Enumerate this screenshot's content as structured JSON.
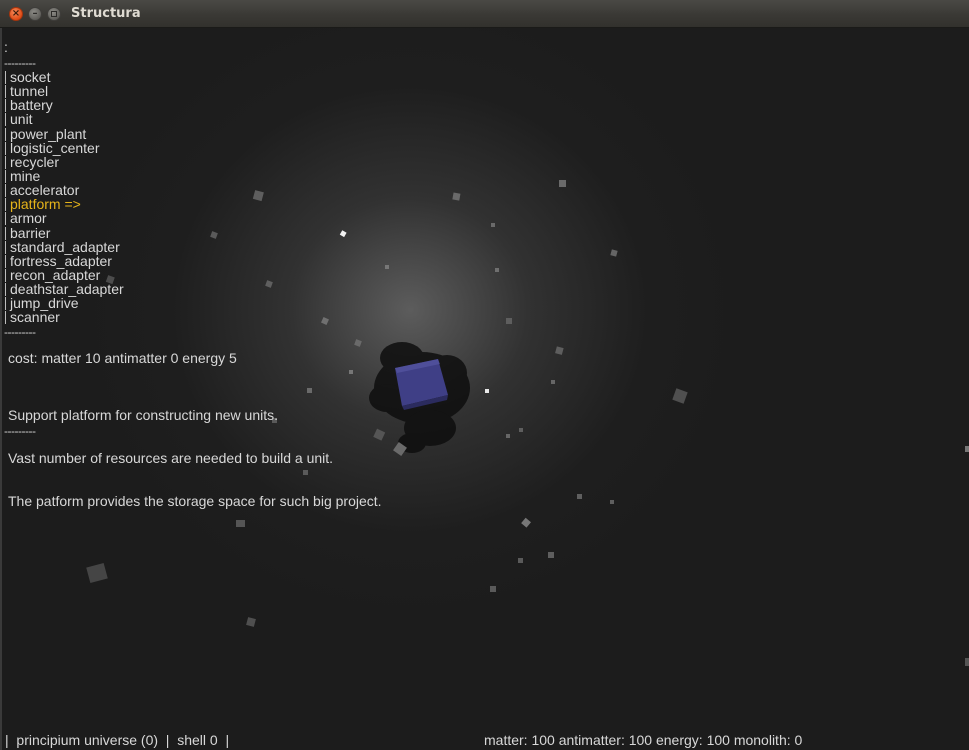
{
  "window": {
    "title": "Structura",
    "close_glyph": "×",
    "minimize_glyph": "–"
  },
  "hud": {
    "prompt": ":",
    "separator": "---------",
    "menu_items": [
      "socket",
      "tunnel",
      "battery",
      "unit",
      "power_plant",
      "logistic_center",
      "recycler",
      "mine",
      "accelerator",
      "platform =>",
      "armor",
      "barrier",
      "standard_adapter",
      "fortress_adapter",
      "recon_adapter",
      "deathstar_adapter",
      "jump_drive",
      "scanner"
    ],
    "selected_index": 9,
    "cost": "cost: matter 10 antimatter 0 energy 5",
    "description": [
      "Support platform for constructing new units.",
      "Vast number of resources are needed to build a unit.",
      "The patform provides the storage space for such big project."
    ]
  },
  "status_bar": {
    "left": "|  principium universe (0)  |  shell 0  |",
    "right": "matter: 100 antimatter: 100 energy: 100 monolith: 0"
  },
  "colors": {
    "hud_text": "#d8d8d8",
    "selected": "#e6b41a",
    "unit_cube": "#3f3f86",
    "background": "#1c1c1c",
    "titlebar": "#3a3935",
    "close_button": "#df4b16"
  }
}
